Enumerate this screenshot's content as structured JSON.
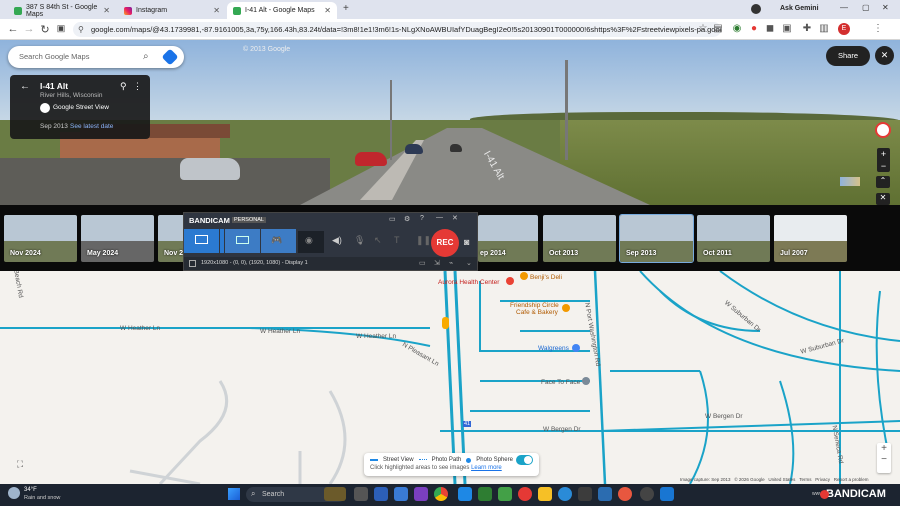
{
  "browser": {
    "tabs": [
      {
        "label": "387 S 84th St - Google Maps",
        "active": false
      },
      {
        "label": "Instagram",
        "active": false
      },
      {
        "label": "I-41 Alt - Google Maps",
        "active": true
      }
    ],
    "url": "google.com/maps/@43.1739981,-87.9161005,3a,75y,166.43h,83.24t/data=!3m8!1e1!3m6!1s-NLgXNoAWBUIafYDuagBegI2e0!5s20130901T000000!6shttps%3F%2Fstreetviewpixels-pa.googleapis.com%2Fv1...",
    "ask_gemini": "Ask Gemini",
    "profile_initial": "E"
  },
  "streetview": {
    "search_placeholder": "Search Google Maps",
    "place_title": "I-41 Alt",
    "place_subtitle": "River Hills, Wisconsin",
    "source": "Google Street View",
    "date": "Sep 2013",
    "latest_link": "See latest date",
    "share_label": "Share",
    "road_text": "I-41 Alt",
    "watermark": "© 2013 Google"
  },
  "timeline": {
    "thumbs": [
      "Nov 2024",
      "May 2024",
      "Nov 2",
      "ep 2014",
      "Oct 2013",
      "Sep 2013",
      "Oct 2011",
      "Jul 2007"
    ],
    "selected": "Sep 2013"
  },
  "bandicam": {
    "title": "BANDICAM",
    "edition": "PERSONAL",
    "rec_label": "REC",
    "resolution_line": "1920x1080 - (0, 0), (1920, 1080) - Display 1"
  },
  "map": {
    "labels": {
      "aurora": "Aurora Health Center",
      "benjis": "Benji's Deli",
      "friendship1": "Friendship Circle",
      "friendship2": "Cafe & Bakery",
      "walgreens": "Walgreens",
      "face": "Face To Face",
      "heather1": "W Heather Ln",
      "heather2": "W Heather Ln",
      "heather3": "W Heather Ln",
      "pleasant": "N Pleasant Ln",
      "port_wash": "N Port Washington Rd",
      "bergen1": "W Bergen Dr",
      "bergen2": "W Bergen Dr",
      "suburban1": "W Suburban Dr",
      "suburban2": "W Suburban Dr",
      "seneca": "N Seneca Rd",
      "beach": "N Beach Rd",
      "route": "41"
    },
    "legend": {
      "street_view": "Street View",
      "photo_path": "Photo Path",
      "photo_sphere": "Photo Sphere",
      "hint": "Click highlighted areas to see images",
      "learn_more": "Learn more"
    },
    "attribution": [
      "Image capture: Sep 2013",
      "© 2026 Google",
      "United States",
      "Terms",
      "Privacy",
      "Report a problem"
    ],
    "colors": {
      "road": "#1aa3c8",
      "street_view": "#1e88e5"
    }
  },
  "taskbar": {
    "weather_temp": "34°F",
    "weather_text": "Rain and snow",
    "search_placeholder": "Search",
    "bandicam_wm": "BANDICAM",
    "wm_prefix": "www."
  }
}
